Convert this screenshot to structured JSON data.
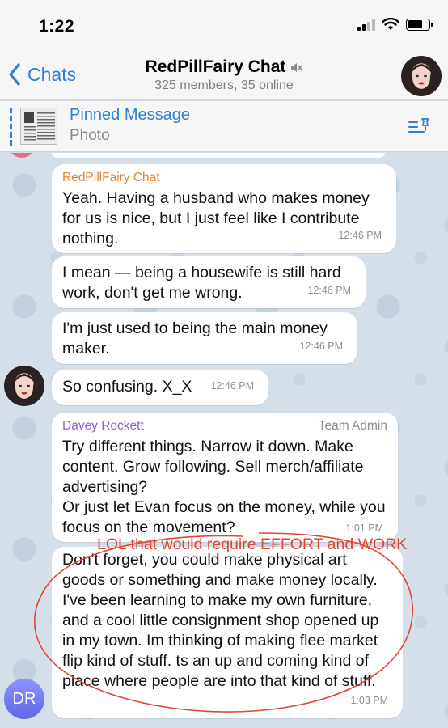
{
  "status_bar": {
    "time": "1:22"
  },
  "nav": {
    "back_label": "Chats",
    "title": "RedPillFairy Chat",
    "subtitle": "325 members, 35 online"
  },
  "pinned": {
    "title": "Pinned Message",
    "subtitle": "Photo"
  },
  "messages": [
    {
      "sender": "RedPillFairy Chat",
      "text": "Yeah. Having a husband who makes money for us is nice, but I just feel like I contribute nothing.",
      "time": "12:46 PM"
    },
    {
      "text": "I mean — being a housewife is still hard work, don't get me wrong.",
      "time": "12:46 PM"
    },
    {
      "text": "I'm just used to being the main money maker.",
      "time": "12:46 PM"
    },
    {
      "text": "So confusing. X_X",
      "time": "12:46 PM"
    },
    {
      "sender": "Davey Rockett",
      "role": "Team Admin",
      "text": "Try different things. Narrow it down. Make content. Grow following. Sell merch/affiliate advertising?\nOr just let Evan focus on the money, while you focus on the movement?",
      "time": "1:01 PM"
    },
    {
      "text": "Don't forget, you could make physical art goods or something and make money locally. I've been learning to make my own furniture, and a cool little consignment shop opened up in my town. Im thinking of making flee market flip kind of stuff. ts an up and coming kind of place where people are into that kind of stuff.",
      "time": "1:03 PM"
    }
  ],
  "avatar_initials": "DR",
  "annotation": {
    "text": "LOL that would require EFFORT and WORK",
    "color": "#e04535"
  },
  "colors": {
    "accent": "#2f7fd8",
    "sender_orange": "#e8822e",
    "sender_purple": "#8e62c9",
    "chat_background": "#d5dfe9"
  }
}
